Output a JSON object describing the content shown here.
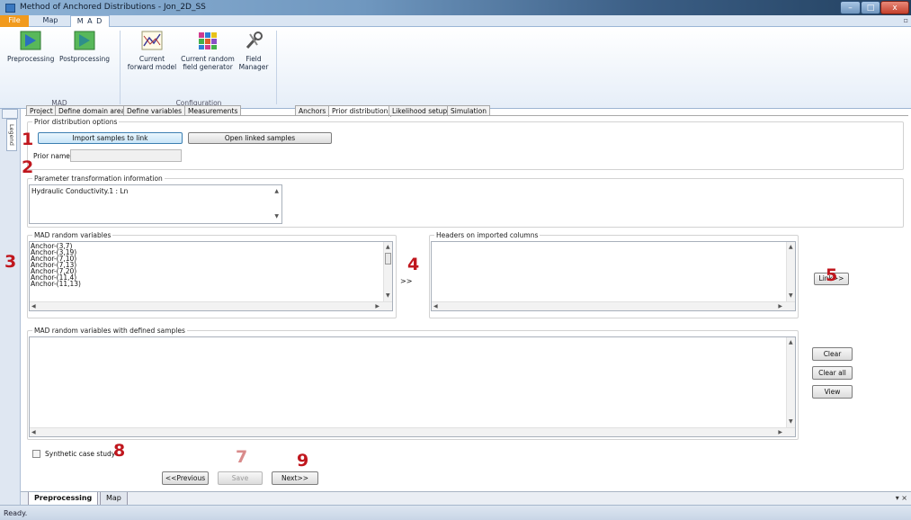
{
  "window": {
    "title": "Method of Anchored Distributions - Jon_2D_SS"
  },
  "ribbon": {
    "tabs": [
      "File",
      "Map",
      "M A D"
    ],
    "buttons": {
      "preprocessing": "Preprocessing",
      "postprocessing": "Postprocessing",
      "forward_model": [
        "Current",
        "forward model"
      ],
      "random_field": [
        "Current random",
        "field generator"
      ],
      "field_manager": [
        "Field",
        "Manager"
      ]
    },
    "groups": {
      "mad": "MAD",
      "configuration": "Configuration"
    }
  },
  "legend": {
    "label": "Legend"
  },
  "workflow_tabs": [
    "Project",
    "Define domain area",
    "Define variables",
    "Measurements",
    "Anchors",
    "Prior distribution",
    "Likelihood setup",
    "Simulation"
  ],
  "prior_options": {
    "title": "Prior distribution options",
    "import_button": "Import samples to link",
    "open_button": "Open linked samples",
    "prior_name_label": "Prior name:",
    "prior_name_value": ""
  },
  "transform": {
    "title": "Parameter transformation information",
    "text": "Hydraulic Conductivity.1 : Ln"
  },
  "random_vars": {
    "title": "MAD random variables",
    "items": [
      "Anchor-(3,7)",
      "Anchor-(3,19)",
      "Anchor-(7,10)",
      "Anchor-(7,13)",
      "Anchor-(7,20)",
      "Anchor-(11,4)",
      "Anchor-(11,13)"
    ]
  },
  "move_button": ">>",
  "headers": {
    "title": "Headers on imported columns"
  },
  "link_button": "Link>>",
  "defined": {
    "title": "MAD random variables with defined samples"
  },
  "side_buttons": {
    "clear": "Clear",
    "clear_all": "Clear all",
    "view": "View"
  },
  "synthetic": {
    "label": "Synthetic case study",
    "checked": false
  },
  "nav": {
    "previous": "<<Previous",
    "save": "Save",
    "next": "Next>>"
  },
  "annotations": [
    "1",
    "2",
    "3",
    "4",
    "5",
    "7",
    "8",
    "9"
  ],
  "doc_tabs": [
    "Preprocessing",
    "Map"
  ],
  "doc_tabs_menu": "▾ ×",
  "status": "Ready."
}
